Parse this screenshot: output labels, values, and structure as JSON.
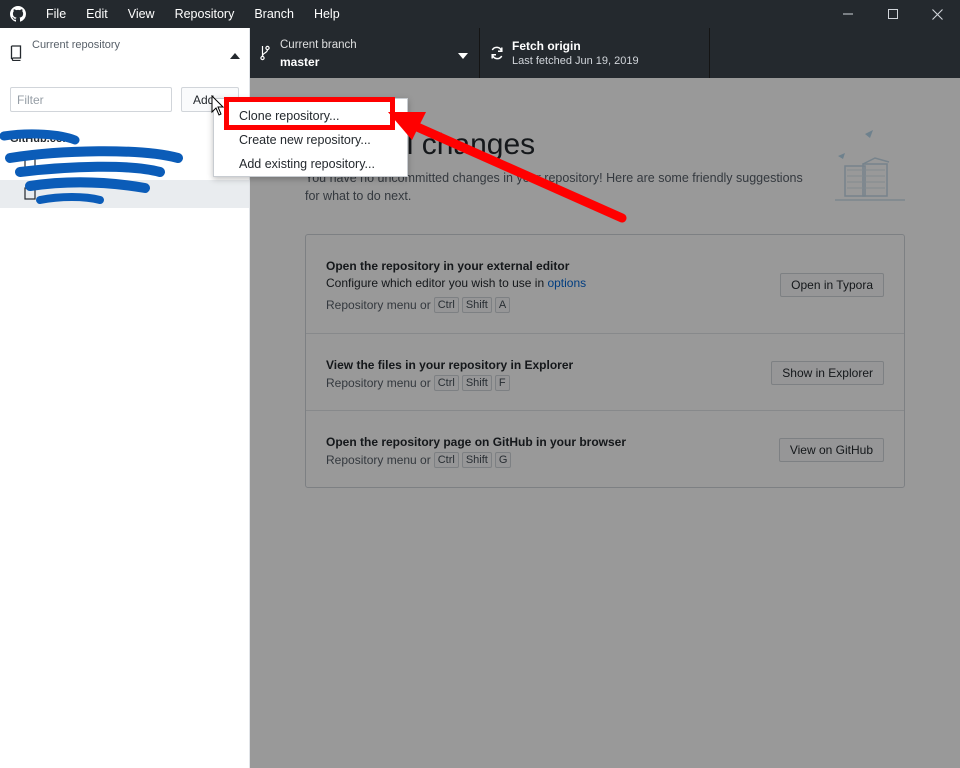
{
  "menu": {
    "items": [
      "File",
      "Edit",
      "View",
      "Repository",
      "Branch",
      "Help"
    ]
  },
  "toolbar": {
    "repo_label": "Current repository",
    "branch_label": "Current branch",
    "branch_value": "master",
    "fetch_label": "Fetch origin",
    "fetch_sub": "Last fetched Jun 19, 2019"
  },
  "sidebar": {
    "filter_placeholder": "Filter",
    "add_label": "Add",
    "group_header": "GitHub.com"
  },
  "dropdown": {
    "items": [
      "Clone repository...",
      "Create new repository...",
      "Add existing repository..."
    ]
  },
  "main": {
    "title": "No local changes",
    "description": "You have no uncommitted changes in your repository! Here are some friendly suggestions for what to do next.",
    "suggestions": [
      {
        "title": "Open the repository in your external editor",
        "desc_prefix": "Configure which editor you wish to use in ",
        "desc_link": "options",
        "shortcut_prefix": "Repository menu or",
        "keys": [
          "Ctrl",
          "Shift",
          "A"
        ],
        "button": "Open in Typora"
      },
      {
        "title": "View the files in your repository in Explorer",
        "shortcut_prefix": "Repository menu or",
        "keys": [
          "Ctrl",
          "Shift",
          "F"
        ],
        "button": "Show in Explorer"
      },
      {
        "title": "Open the repository page on GitHub in your browser",
        "shortcut_prefix": "Repository menu or",
        "keys": [
          "Ctrl",
          "Shift",
          "G"
        ],
        "button": "View on GitHub"
      }
    ]
  },
  "colors": {
    "titlebar": "#24292e",
    "link": "#0366d6",
    "annotation": "#ff0000",
    "redaction": "#0b5cb8"
  }
}
